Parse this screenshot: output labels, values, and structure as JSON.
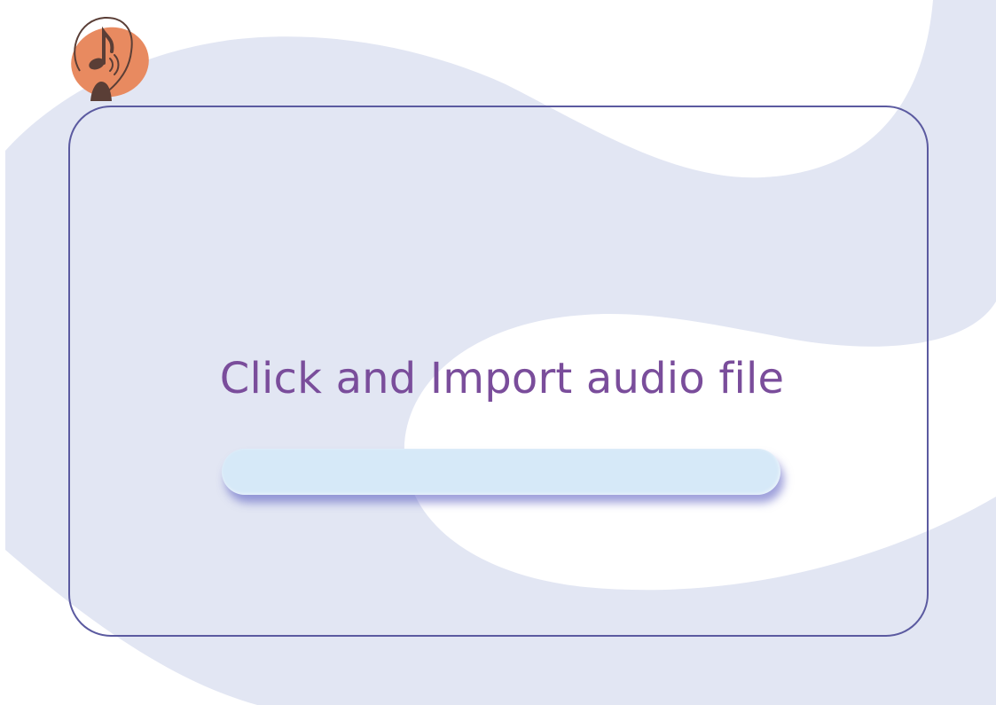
{
  "upload": {
    "prompt_label": "Click and Import audio file",
    "progress_fraction": 0
  },
  "icons": {
    "logo": "music-note-headphones-icon"
  },
  "colors": {
    "prompt_text": "#7a4d9b",
    "frame_border": "#5b5aa0",
    "background_wave": "#e2e6f3",
    "progress_track": "#d6e9f8",
    "progress_shadow": "#5054be",
    "logo_blob": "#e88a60",
    "logo_ink": "#5a3e36"
  }
}
